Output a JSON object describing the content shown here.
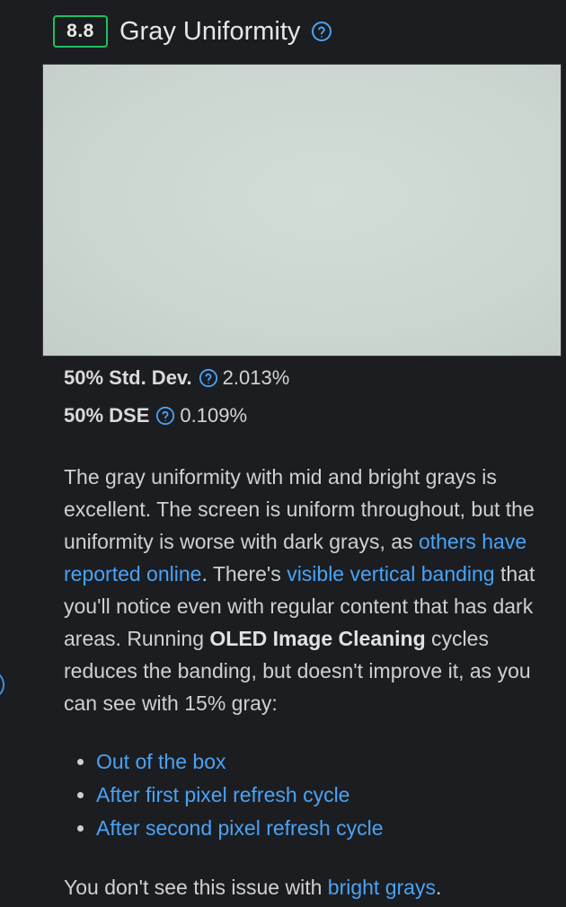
{
  "header": {
    "score": "8.8",
    "title": "Gray Uniformity",
    "help_icon": "question-circle-icon",
    "score_color": "#1fbf62"
  },
  "measurements": [
    {
      "label": "50% Std. Dev.",
      "value": "2.013%"
    },
    {
      "label": "50% DSE",
      "value": "0.109%"
    }
  ],
  "paragraph": {
    "text_1": "The gray uniformity with mid and bright grays is excellent. The screen is uniform throughout, but the uniformity is worse with dark grays, as ",
    "link_1": "others have reported online",
    "text_2": ". There's ",
    "link_2": "visible vertical banding",
    "text_3": " that you'll notice even with regular content that has dark areas. Running ",
    "bold_1": "OLED Image Cleaning",
    "text_4": " cycles reduces the banding, but doesn't improve it, as you can see with 15% gray:"
  },
  "bullets": [
    "Out of the box",
    "After first pixel refresh cycle",
    "After second pixel refresh cycle"
  ],
  "closing": {
    "text_1": "You don't see this issue with ",
    "link": "bright grays",
    "text_2": "."
  },
  "colors": {
    "background": "#1c1d21",
    "link": "#4aa3f5",
    "text": "#d0d0d0"
  }
}
